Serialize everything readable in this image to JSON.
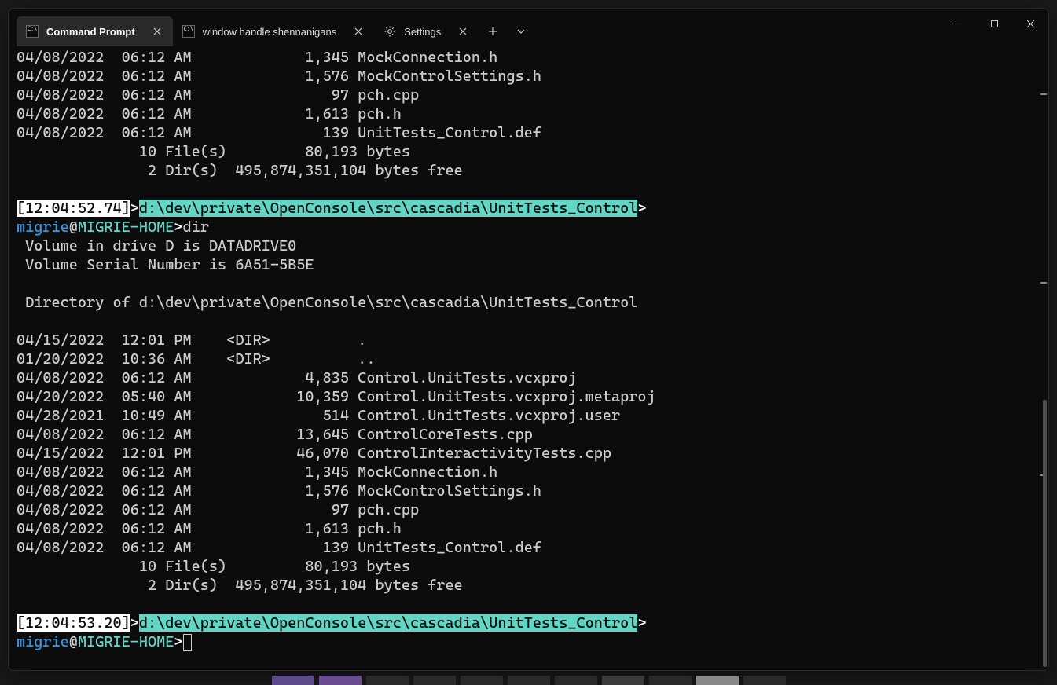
{
  "tabs": [
    {
      "label": "Command Prompt",
      "icon": "cmd",
      "active": true
    },
    {
      "label": "window handle shennanigans",
      "icon": "cmd",
      "active": false
    },
    {
      "label": "Settings",
      "icon": "gear",
      "active": false
    }
  ],
  "colors": {
    "path_bg": "#61d6c4",
    "time_bg": "#ffffff",
    "user_fg": "#3a96dd",
    "host_fg": "#61d6c4"
  },
  "term": {
    "top_lines": [
      "04/08/2022  06:12 AM             1,345 MockConnection.h",
      "04/08/2022  06:12 AM             1,576 MockControlSettings.h",
      "04/08/2022  06:12 AM                97 pch.cpp",
      "04/08/2022  06:12 AM             1,613 pch.h",
      "04/08/2022  06:12 AM               139 UnitTests_Control.def",
      "              10 File(s)         80,193 bytes",
      "               2 Dir(s)  495,874,351,104 bytes free"
    ],
    "prompt1_time": "[12:04:52.74]",
    "prompt1_path": "d:\\dev\\private\\OpenConsole\\src\\cascadia\\UnitTests_Control",
    "prompt1_gt": ">",
    "user": "migrie",
    "at": "@",
    "host": "MIGRIE-HOME",
    "host_gt": ">",
    "cmd1": "dir",
    "dir_lines": [
      " Volume in drive D is DATADRIVE0",
      " Volume Serial Number is 6A51-5B5E",
      "",
      " Directory of d:\\dev\\private\\OpenConsole\\src\\cascadia\\UnitTests_Control",
      "",
      "04/15/2022  12:01 PM    <DIR>          .",
      "01/20/2022  10:36 AM    <DIR>          ..",
      "04/08/2022  06:12 AM             4,835 Control.UnitTests.vcxproj",
      "04/20/2022  05:40 AM            10,359 Control.UnitTests.vcxproj.metaproj",
      "04/28/2021  10:49 AM               514 Control.UnitTests.vcxproj.user",
      "04/08/2022  06:12 AM            13,645 ControlCoreTests.cpp",
      "04/15/2022  12:01 PM            46,070 ControlInteractivityTests.cpp",
      "04/08/2022  06:12 AM             1,345 MockConnection.h",
      "04/08/2022  06:12 AM             1,576 MockControlSettings.h",
      "04/08/2022  06:12 AM                97 pch.cpp",
      "04/08/2022  06:12 AM             1,613 pch.h",
      "04/08/2022  06:12 AM               139 UnitTests_Control.def",
      "              10 File(s)         80,193 bytes",
      "               2 Dir(s)  495,874,351,104 bytes free"
    ],
    "prompt2_time": "[12:04:53.20]",
    "prompt2_path": "d:\\dev\\private\\OpenConsole\\src\\cascadia\\UnitTests_Control",
    "prompt2_gt": ">"
  },
  "taskbar": [
    "#5b4b8a",
    "#6a4c93",
    "#2a2a2a",
    "#2a2a2a",
    "#2a2a2a",
    "#2a2a2a",
    "#2a2a2a",
    "#3a3a3a",
    "#2a2a2a",
    "#888",
    "#2a2a2a"
  ]
}
